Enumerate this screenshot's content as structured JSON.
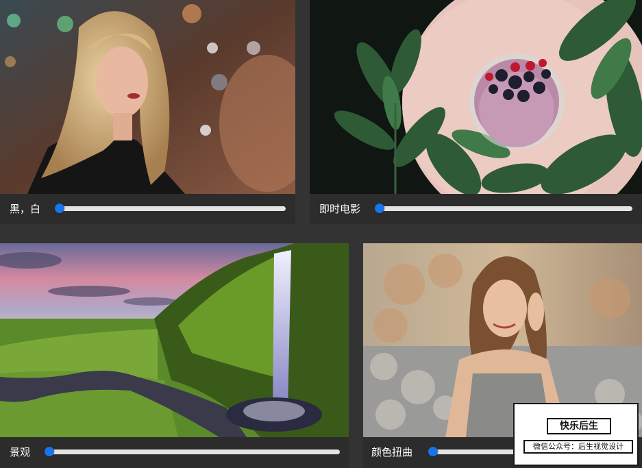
{
  "filters": [
    {
      "label": "黑，白",
      "value": 0.0
    },
    {
      "label": "即时电影",
      "value": 0.0
    },
    {
      "label": "景观",
      "value": 0.0
    },
    {
      "label": "颜色扭曲",
      "value": 0.0
    }
  ],
  "watermark": {
    "title": "快乐后生",
    "subtitle": "微信公众号：后生视觉设计"
  },
  "colors": {
    "background": "#333333",
    "control_bar": "#2c2c2c",
    "slider_track": "#e3e3e3",
    "slider_thumb": "#1a73e8"
  }
}
